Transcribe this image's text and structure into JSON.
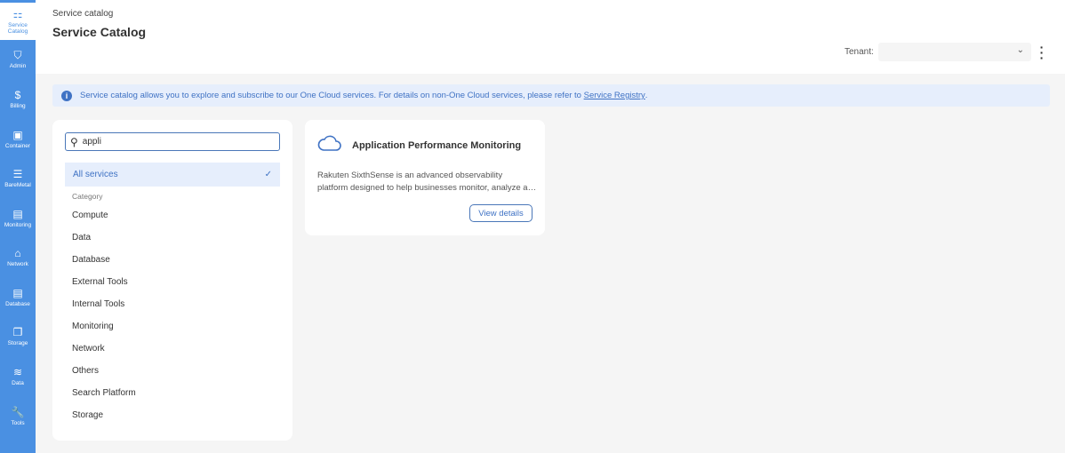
{
  "sidebar": {
    "items": [
      {
        "label": "Service Catalog",
        "icon": "hierarchy-icon",
        "glyph": "⚏",
        "active": true
      },
      {
        "label": "Admin",
        "icon": "shield-icon",
        "glyph": "⛉"
      },
      {
        "label": "Billing",
        "icon": "dollar-icon",
        "glyph": "$"
      },
      {
        "label": "Container",
        "icon": "container-icon",
        "glyph": "▣"
      },
      {
        "label": "BareMetal",
        "icon": "list-icon",
        "glyph": "☰"
      },
      {
        "label": "Monitoring",
        "icon": "monitor-icon",
        "glyph": "▤"
      },
      {
        "label": "Network",
        "icon": "router-icon",
        "glyph": "⌂"
      },
      {
        "label": "Database",
        "icon": "database-icon",
        "glyph": "▤"
      },
      {
        "label": "Storage",
        "icon": "storage-icon",
        "glyph": "❐"
      },
      {
        "label": "Data",
        "icon": "data-icon",
        "glyph": "≋"
      },
      {
        "label": "Tools",
        "icon": "wrench-icon",
        "glyph": "🔧"
      }
    ]
  },
  "header": {
    "breadcrumb": "Service catalog",
    "title": "Service Catalog",
    "tenant_label": "Tenant:",
    "tenant_value": ""
  },
  "info": {
    "text": "Service catalog allows you to explore and subscribe to our One Cloud services. For details on non-One Cloud services, please refer to ",
    "link": "Service Registry",
    "suffix": "."
  },
  "filter": {
    "search_value": "appli",
    "all_label": "All services",
    "category_label": "Category",
    "categories": [
      "Compute",
      "Data",
      "Database",
      "External Tools",
      "Internal Tools",
      "Monitoring",
      "Network",
      "Others",
      "Search Platform",
      "Storage"
    ]
  },
  "card": {
    "title": "Application Performance Monitoring",
    "desc_line1": "Rakuten SixthSense is an advanced observability",
    "desc_line2": "platform designed to help businesses monitor, analyze and optimize",
    "button": "View details"
  },
  "colors": {
    "sidebar": "#4a90e2",
    "accent": "#3f72c4"
  }
}
